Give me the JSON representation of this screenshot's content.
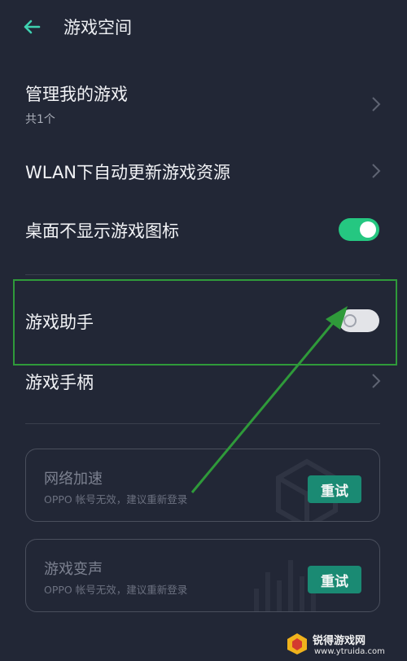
{
  "header": {
    "title": "游戏空间"
  },
  "rows": {
    "manage": {
      "title": "管理我的游戏",
      "sub": "共1个"
    },
    "wlan": {
      "title": "WLAN下自动更新游戏资源"
    },
    "hide_icon": {
      "title": "桌面不显示游戏图标",
      "toggle": true
    },
    "assistant": {
      "title": "游戏助手",
      "toggle": false
    },
    "gamepad": {
      "title": "游戏手柄"
    }
  },
  "cards": [
    {
      "title": "网络加速",
      "sub": "OPPO 帐号无效，建议重新登录",
      "button": "重试"
    },
    {
      "title": "游戏变声",
      "sub": "OPPO 帐号无效，建议重新登录",
      "button": "重试"
    }
  ],
  "watermark": {
    "text": "锐得游戏网",
    "url": "www.ytruida.com"
  },
  "colors": {
    "background": "#222736",
    "accent": "#25c781",
    "highlight": "#2f9a3a",
    "button": "#1a8a73"
  }
}
